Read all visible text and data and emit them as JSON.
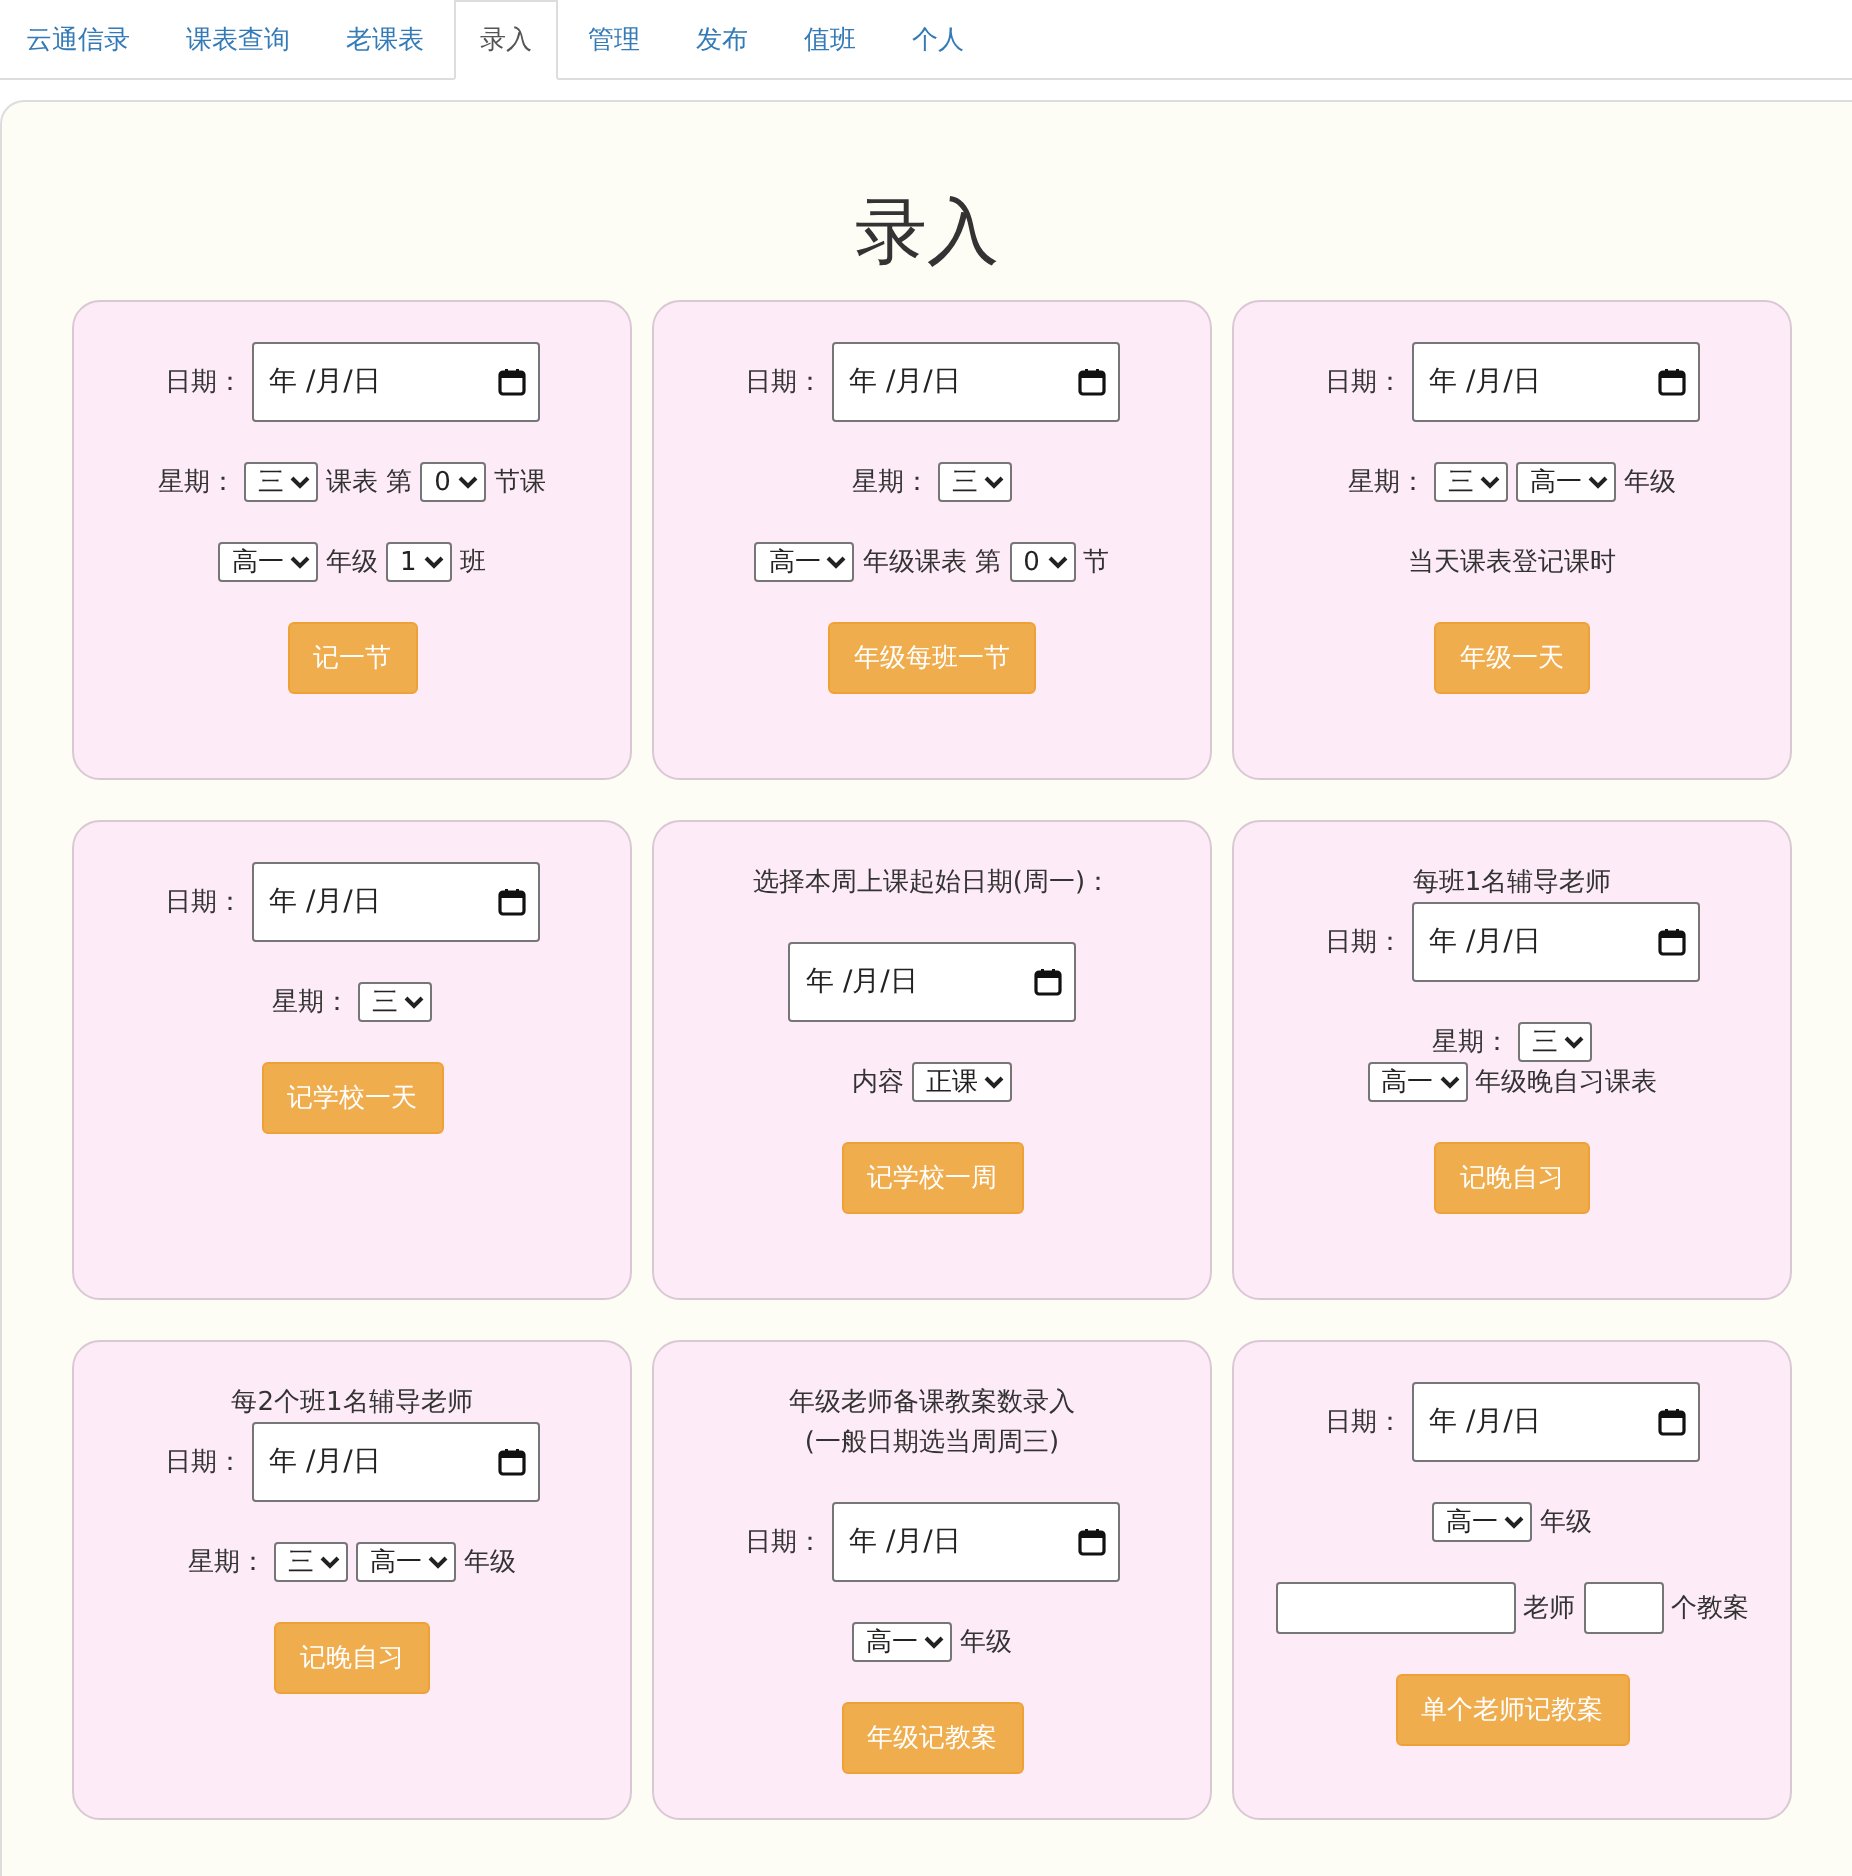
{
  "tabs": [
    {
      "label": "云通信录",
      "selected": false
    },
    {
      "label": "课表查询",
      "selected": false
    },
    {
      "label": "老课表",
      "selected": false
    },
    {
      "label": "录入",
      "selected": true
    },
    {
      "label": "管理",
      "selected": false
    },
    {
      "label": "发布",
      "selected": false
    },
    {
      "label": "值班",
      "selected": false
    },
    {
      "label": "个人",
      "selected": false
    }
  ],
  "title": "录入",
  "cards": [
    {
      "blocks": [
        [
          [
            {
              "kind": "label",
              "text": "日期："
            },
            {
              "kind": "date",
              "text": "年 /月/日"
            }
          ]
        ],
        [
          [
            {
              "kind": "label",
              "text": "星期："
            },
            {
              "kind": "select",
              "value": "三"
            },
            {
              "kind": "label",
              "text": "课表 第"
            },
            {
              "kind": "select",
              "value": "0"
            },
            {
              "kind": "label",
              "text": "节课"
            }
          ]
        ],
        [
          [
            {
              "kind": "select",
              "value": "高一"
            },
            {
              "kind": "label",
              "text": "年级"
            },
            {
              "kind": "select",
              "value": "1"
            },
            {
              "kind": "label",
              "text": "班"
            }
          ]
        ]
      ],
      "button": "记一节"
    },
    {
      "blocks": [
        [
          [
            {
              "kind": "label",
              "text": "日期："
            },
            {
              "kind": "date",
              "text": "年 /月/日"
            }
          ]
        ],
        [
          [
            {
              "kind": "label",
              "text": "星期："
            },
            {
              "kind": "select",
              "value": "三"
            }
          ]
        ],
        [
          [
            {
              "kind": "select",
              "value": "高一"
            },
            {
              "kind": "label",
              "text": "年级课表 第"
            },
            {
              "kind": "select",
              "value": "0"
            },
            {
              "kind": "label",
              "text": "节"
            }
          ]
        ]
      ],
      "button": "年级每班一节"
    },
    {
      "blocks": [
        [
          [
            {
              "kind": "label",
              "text": "日期："
            },
            {
              "kind": "date",
              "text": "年 /月/日"
            }
          ]
        ],
        [
          [
            {
              "kind": "label",
              "text": "星期："
            },
            {
              "kind": "select",
              "value": "三"
            },
            {
              "kind": "select",
              "value": "高一"
            },
            {
              "kind": "label",
              "text": "年级"
            }
          ]
        ],
        [
          [
            {
              "kind": "label",
              "text": "当天课表登记课时"
            }
          ]
        ]
      ],
      "button": "年级一天"
    },
    {
      "blocks": [
        [
          [
            {
              "kind": "label",
              "text": "日期："
            },
            {
              "kind": "date",
              "text": "年 /月/日"
            }
          ]
        ],
        [
          [
            {
              "kind": "label",
              "text": "星期："
            },
            {
              "kind": "select",
              "value": "三"
            }
          ]
        ]
      ],
      "button": "记学校一天"
    },
    {
      "blocks": [
        [
          [
            {
              "kind": "label",
              "text": "选择本周上课起始日期(周一)："
            }
          ]
        ],
        [
          [
            {
              "kind": "date",
              "text": "年 /月/日"
            }
          ]
        ],
        [
          [
            {
              "kind": "label",
              "text": "内容"
            },
            {
              "kind": "select",
              "value": "正课"
            }
          ]
        ]
      ],
      "button": "记学校一周"
    },
    {
      "blocks": [
        [
          [
            {
              "kind": "label",
              "text": "每班1名辅导老师"
            }
          ],
          [
            {
              "kind": "label",
              "text": "日期："
            },
            {
              "kind": "date",
              "text": "年 /月/日"
            }
          ]
        ],
        [
          [
            {
              "kind": "label",
              "text": "星期："
            },
            {
              "kind": "select",
              "value": "三"
            }
          ],
          [
            {
              "kind": "select",
              "value": "高一"
            },
            {
              "kind": "label",
              "text": "年级晚自习课表"
            }
          ]
        ]
      ],
      "button": "记晚自习"
    },
    {
      "blocks": [
        [
          [
            {
              "kind": "label",
              "text": "每2个班1名辅导老师"
            }
          ],
          [
            {
              "kind": "label",
              "text": "日期："
            },
            {
              "kind": "date",
              "text": "年 /月/日"
            }
          ]
        ],
        [
          [
            {
              "kind": "label",
              "text": "星期："
            },
            {
              "kind": "select",
              "value": "三"
            },
            {
              "kind": "select",
              "value": "高一"
            },
            {
              "kind": "label",
              "text": "年级"
            }
          ]
        ]
      ],
      "button": "记晚自习"
    },
    {
      "blocks": [
        [
          [
            {
              "kind": "label",
              "text": "年级老师备课教案数录入"
            }
          ],
          [
            {
              "kind": "label",
              "text": "(一般日期选当周周三)"
            }
          ]
        ],
        [
          [
            {
              "kind": "label",
              "text": "日期："
            },
            {
              "kind": "date",
              "text": "年 /月/日"
            }
          ]
        ],
        [
          [
            {
              "kind": "select",
              "value": "高一"
            },
            {
              "kind": "label",
              "text": "年级"
            }
          ]
        ]
      ],
      "button": "年级记教案"
    },
    {
      "blocks": [
        [
          [
            {
              "kind": "label",
              "text": "日期："
            },
            {
              "kind": "date",
              "text": "年 /月/日"
            }
          ]
        ],
        [
          [
            {
              "kind": "select",
              "value": "高一"
            },
            {
              "kind": "label",
              "text": "年级"
            }
          ]
        ],
        [
          [
            {
              "kind": "name_input"
            },
            {
              "kind": "label",
              "text": "老师"
            },
            {
              "kind": "count_input"
            },
            {
              "kind": "label",
              "text": "个教案"
            }
          ]
        ]
      ],
      "button": "单个老师记教案"
    }
  ]
}
